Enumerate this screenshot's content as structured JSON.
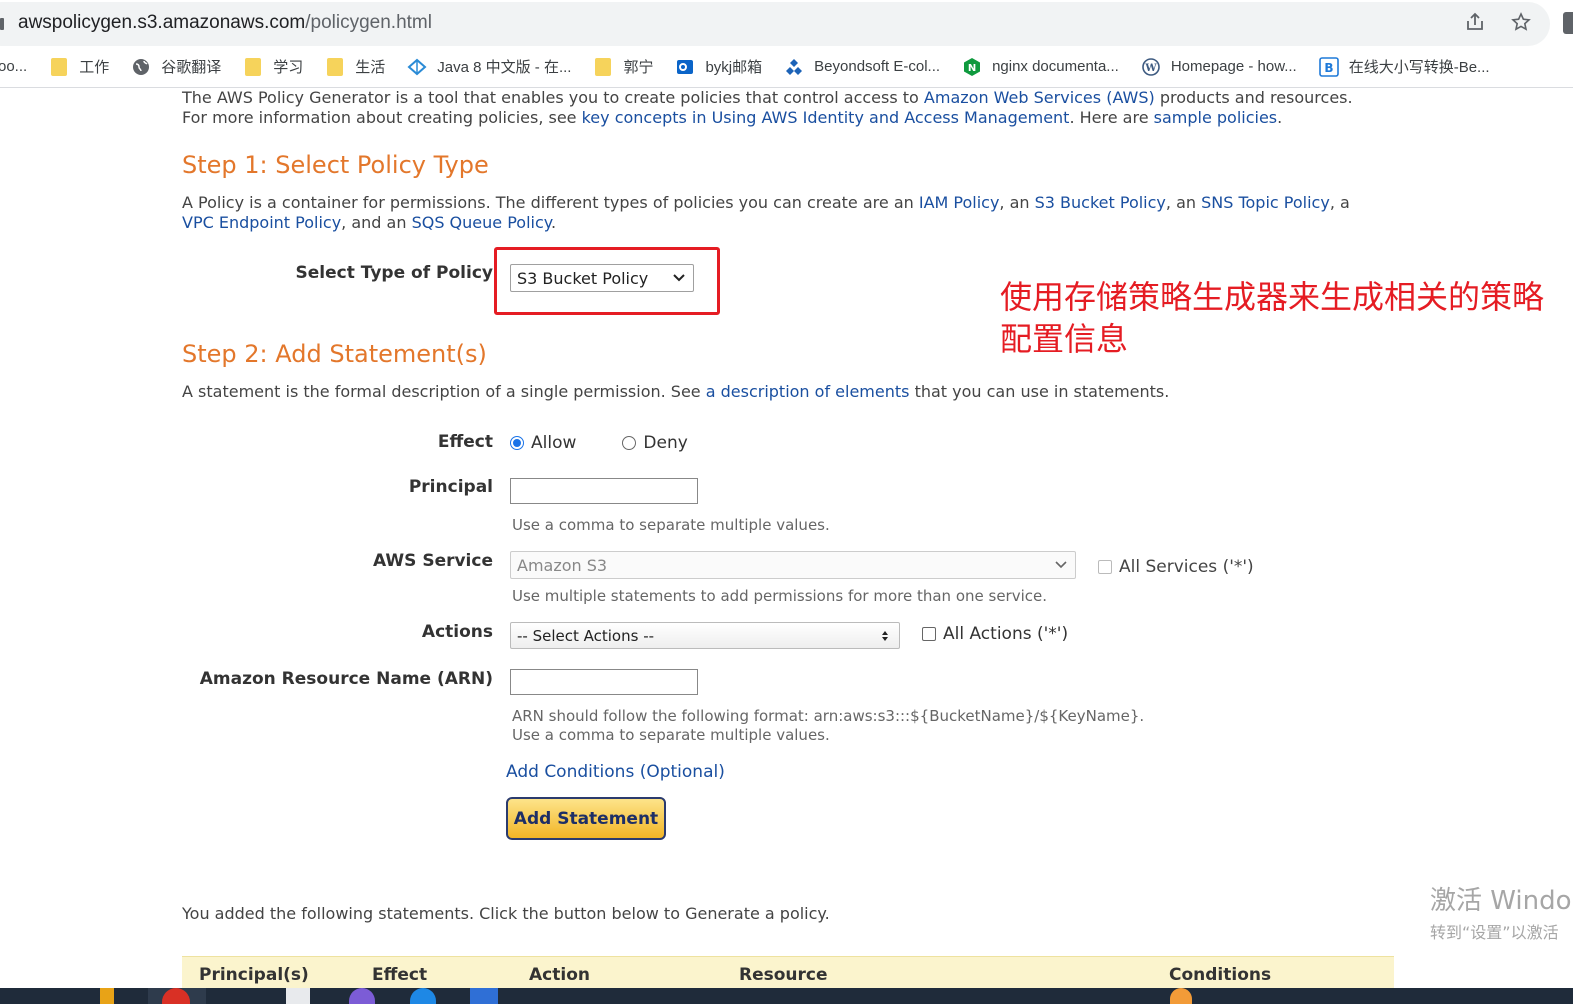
{
  "browser": {
    "url_main": "awspolicygen.s3.amazonaws.com",
    "url_path": "/policygen.html"
  },
  "bookmarks": [
    {
      "label": "oo...",
      "icon": "none"
    },
    {
      "label": "工作",
      "icon": "folder-icon"
    },
    {
      "label": "谷歌翻译",
      "icon": "globe-icon"
    },
    {
      "label": "学习",
      "icon": "folder-icon"
    },
    {
      "label": "生活",
      "icon": "folder-icon"
    },
    {
      "label": "Java 8 中文版 - 在...",
      "icon": "diamond-icon"
    },
    {
      "label": "郭宁",
      "icon": "folder-icon"
    },
    {
      "label": "bykj邮箱",
      "icon": "outlook-icon"
    },
    {
      "label": "Beyondsoft E-col...",
      "icon": "beyondsoft-icon"
    },
    {
      "label": "nginx documenta...",
      "icon": "nginx-icon"
    },
    {
      "label": "Homepage - how...",
      "icon": "wordpress-icon"
    },
    {
      "label": "在线大小写转换-Be...",
      "icon": "b-icon"
    }
  ],
  "intro": {
    "line1_a": "The AWS Policy Generator is a tool that enables you to create policies that control access to ",
    "line1_link": "Amazon Web Services (AWS)",
    "line1_b": " products and resources.",
    "line2_a": "For more information about creating policies, see ",
    "line2_link1": "key concepts in Using AWS Identity and Access Management",
    "line2_b": ". Here are ",
    "line2_link2": "sample policies",
    "line2_c": "."
  },
  "step1": {
    "title": "Step 1: Select Policy Type",
    "p_a": "A Policy is a container for permissions. The different types of policies you can create are an ",
    "link_iam": "IAM Policy",
    "p_b": ", an ",
    "link_s3": "S3 Bucket Policy",
    "p_c": ", an ",
    "link_sns": "SNS Topic Policy",
    "p_d": ", a",
    "link_vpc": "VPC Endpoint Policy",
    "p_e": ", and an ",
    "link_sqs": "SQS Queue Policy",
    "p_f": ".",
    "select_label": "Select Type of Policy",
    "select_value": "S3 Bucket Policy"
  },
  "annotation": "使用存储策略生成器来生成相关的策略配置信息",
  "step2": {
    "title": "Step 2: Add Statement(s)",
    "p_a": "A statement is the formal description of a single permission. See ",
    "link": "a description of elements",
    "p_b": " that you can use in statements.",
    "effect_label": "Effect",
    "effect_allow": "Allow",
    "effect_deny": "Deny",
    "principal_label": "Principal",
    "principal_value": "",
    "principal_hint": "Use a comma to separate multiple values.",
    "service_label": "AWS Service",
    "service_value": "Amazon S3",
    "all_services": "All Services ('*')",
    "service_hint": "Use multiple statements to add permissions for more than one service.",
    "actions_label": "Actions",
    "actions_value": "-- Select Actions --",
    "all_actions": "All Actions ('*')",
    "arn_label": "Amazon Resource Name (ARN)",
    "arn_value": "",
    "arn_hint1": "ARN should follow the following format: arn:aws:s3:::${BucketName}/${KeyName}.",
    "arn_hint2": "Use a comma to separate multiple values.",
    "add_conditions": "Add Conditions (Optional)",
    "add_statement": "Add Statement"
  },
  "statements": {
    "intro": "You added the following statements. Click the button below to Generate a policy.",
    "columns": [
      "Principal(s)",
      "Effect",
      "Action",
      "Resource",
      "Conditions"
    ]
  },
  "watermark": {
    "line1": "激活 Windo",
    "line2": "转到“设置”以激活"
  }
}
